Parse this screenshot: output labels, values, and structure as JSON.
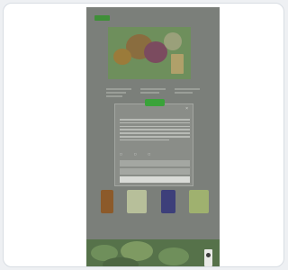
{
  "page": {
    "navigation": {
      "links": [
        "",
        "",
        "",
        "",
        ""
      ]
    },
    "features": [
      {
        "title": ""
      },
      {
        "title": ""
      },
      {
        "title": ""
      }
    ],
    "cookie_modal": {
      "title": "",
      "buttons": [
        {
          "label": ""
        },
        {
          "label": ""
        },
        {
          "label": ""
        }
      ]
    },
    "products": [
      {
        "name": ""
      },
      {
        "name": ""
      },
      {
        "name": ""
      },
      {
        "name": ""
      },
      {
        "name": ""
      }
    ]
  },
  "colors": {
    "brand_green": "#3aa33a",
    "overlay_grey": "#7b7f7a",
    "card_background": "#ffffff",
    "card_border": "#d8dde3"
  },
  "icons": [
    "close-icon",
    "brand-logo",
    "certification-badge"
  ]
}
